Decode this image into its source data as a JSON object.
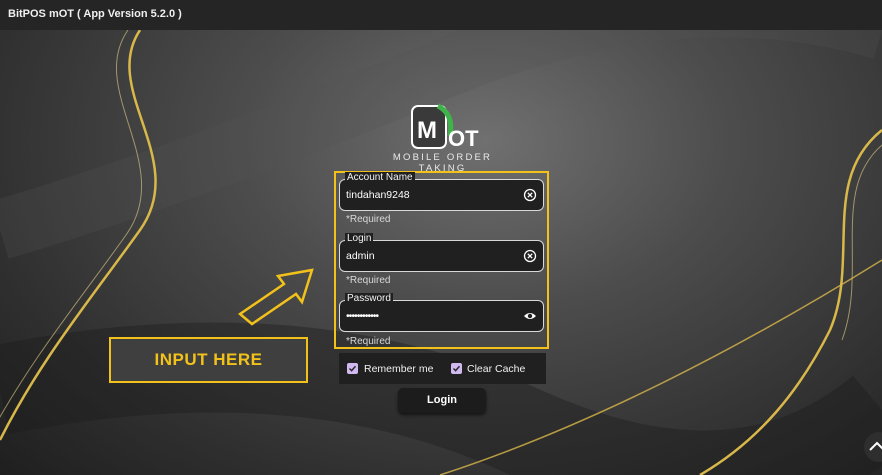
{
  "window": {
    "title": "BitPOS mOT  ( App Version 5.2.0 )"
  },
  "logo": {
    "text": "OT",
    "mark": "M",
    "subtitle": "MOBILE ORDER TAKING"
  },
  "form": {
    "account": {
      "label": "Account Name",
      "value": "tindahan9248",
      "helper": "*Required",
      "icon": "clear-icon"
    },
    "login": {
      "label": "Login",
      "value": "admin",
      "helper": "*Required",
      "icon": "clear-icon"
    },
    "password": {
      "label": "Password",
      "value": "••••••••••••",
      "helper": "*Required",
      "icon": "eye-icon"
    },
    "remember": {
      "label": "Remember me",
      "checked": true
    },
    "clear_cache": {
      "label": "Clear Cache",
      "checked": true
    },
    "submit_label": "Login"
  },
  "annotation": {
    "label": "INPUT HERE",
    "color": "#f2c21b"
  }
}
